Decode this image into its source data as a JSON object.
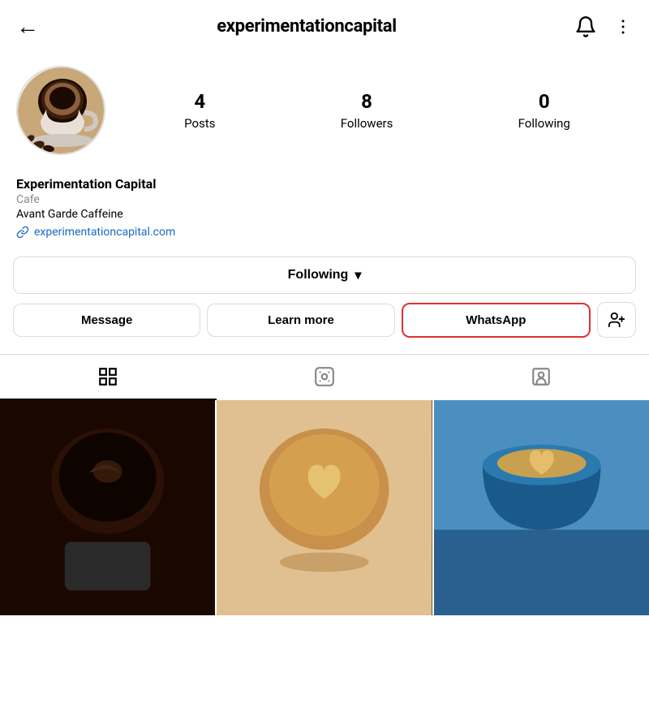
{
  "header": {
    "back_label": "←",
    "username": "experimentationcapital",
    "title": "experimentationcapital"
  },
  "profile": {
    "name": "Experimentation Capital",
    "category": "Cafe",
    "tagline": "Avant Garde Caffeine",
    "website": "experimentationcapital.com",
    "stats": {
      "posts_count": "4",
      "posts_label": "Posts",
      "followers_count": "8",
      "followers_label": "Followers",
      "following_count": "0",
      "following_label": "Following"
    }
  },
  "actions": {
    "following_button": "Following",
    "following_chevron": "▾",
    "message_button": "Message",
    "learn_more_button": "Learn more",
    "whatsapp_button": "WhatsApp"
  },
  "tabs": {
    "grid_label": "Grid",
    "reels_label": "Reels",
    "tagged_label": "Tagged"
  }
}
